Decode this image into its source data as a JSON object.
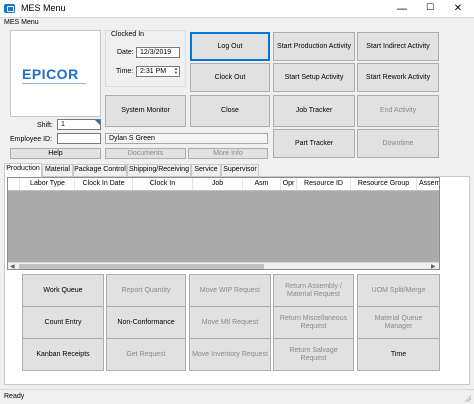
{
  "window": {
    "title": "MES Menu",
    "menu_label": "MES Menu",
    "minimize": "—",
    "maximize": "☐",
    "close": "✕"
  },
  "logo": {
    "text": "EPICOR"
  },
  "clock": {
    "group_title": "Clocked In",
    "date_label": "Date:",
    "date_value": "12/3/2019",
    "time_label": "Time:",
    "time_value": "2:31 PM"
  },
  "employee": {
    "shift_label": "Shift:",
    "shift_value": "1",
    "id_label": "Employee ID:",
    "id_value": "",
    "name_value": "Dylan S Green",
    "help_label": "Help",
    "documents_label": "Documents",
    "more_info_label": "More Info"
  },
  "top_buttons": {
    "log_out": "Log Out",
    "clock_out": "Clock Out",
    "system_monitor": "System Monitor",
    "close": "Close",
    "start_production": "Start Production Activity",
    "start_setup": "Start Setup Activity",
    "job_tracker": "Job Tracker",
    "part_tracker": "Part Tracker",
    "start_indirect": "Start Indirect Activity",
    "start_rework": "Start Rework Activity",
    "end_activity": "End Activity",
    "downtime": "Downtime"
  },
  "tabs": [
    "Production",
    "Material",
    "Package Control",
    "Shipping/Receiving",
    "Service",
    "Supervisor"
  ],
  "grid": {
    "columns": [
      "Labor Type",
      "Clock In Date",
      "Clock In",
      "Job",
      "Asm",
      "Opr",
      "Resource ID",
      "Resource Group",
      "Assem"
    ]
  },
  "bottom_buttons": {
    "work_queue": "Work Queue",
    "report_quantity": "Report Quantity",
    "move_wip": "Move WIP Request",
    "return_assembly": "Return Assembly / Material Request",
    "uom_split": "UOM Split/Merge",
    "count_entry": "Count Entry",
    "non_conformance": "Non-Conformance",
    "move_mtl": "Move Mtl Request",
    "return_misc": "Return Miscellaneous Request",
    "material_queue": "Material Queue Manager",
    "kanban": "Kanban Receipts",
    "get_request": "Get Request",
    "move_inventory": "Move Inventory Request",
    "return_salvage": "Return Salvage Request",
    "time": "Time"
  },
  "status": {
    "text": "Ready"
  },
  "colors": {
    "accent": "#0078d7",
    "logo": "#1e6fcf"
  }
}
